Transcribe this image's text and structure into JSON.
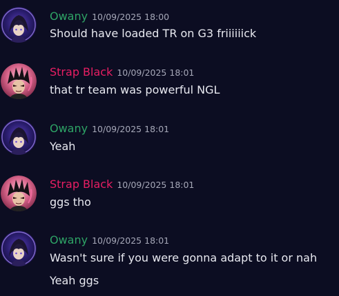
{
  "colors": {
    "background": "#0c0d22",
    "owany_name": "#2ea466",
    "strap_name": "#e91e63",
    "message_text": "#e8e9f0",
    "timestamp": "#a6a8b8"
  },
  "messages": [
    {
      "author": "Owany",
      "timestamp": "10/09/2025 18:00",
      "lines": [
        "Should have loaded TR on G3 friiiiiick"
      ]
    },
    {
      "author": "Strap Black",
      "timestamp": "10/09/2025 18:01",
      "lines": [
        "that tr team was powerful NGL"
      ]
    },
    {
      "author": "Owany",
      "timestamp": "10/09/2025 18:01",
      "lines": [
        "Yeah"
      ]
    },
    {
      "author": "Strap Black",
      "timestamp": "10/09/2025 18:01",
      "lines": [
        "ggs tho"
      ]
    },
    {
      "author": "Owany",
      "timestamp": "10/09/2025 18:01",
      "lines": [
        "Wasn't sure if you were gonna adapt to it or nah",
        "Yeah ggs"
      ]
    }
  ]
}
